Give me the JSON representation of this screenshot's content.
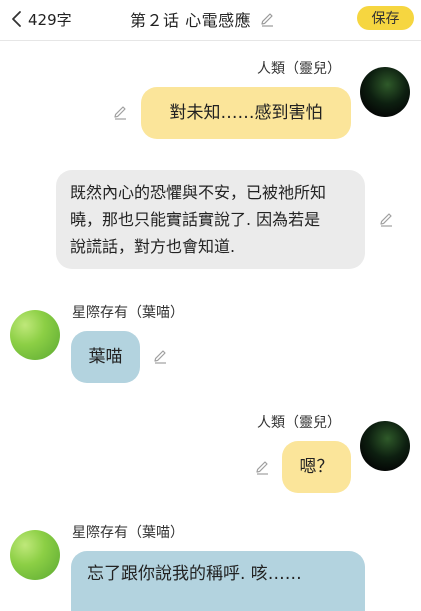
{
  "header": {
    "back_label": "429字",
    "title": "第２话 心電感應",
    "save_label": "保存"
  },
  "messages": [
    {
      "speaker": "人類（靈兒）",
      "text": "對未知……感到害怕"
    },
    {
      "speaker": "",
      "lines": [
        "既然內心的恐懼與不安，已被祂所知",
        "曉，那也只能實話實說了.  因為若是",
        "說謊話，對方也會知道."
      ]
    },
    {
      "speaker": "星際存有（葉喵）",
      "text": "葉喵"
    },
    {
      "speaker": "人類（靈兒）",
      "text": "嗯？"
    },
    {
      "speaker": "星際存有（葉喵）",
      "text": "忘了跟你說我的稱呼.  咳……"
    }
  ],
  "colors": {
    "accent": "#f6d640",
    "bubble_user": "#fbe59a",
    "bubble_other": "#b3d3df",
    "bubble_narration": "#ebebeb"
  },
  "icons": {
    "back": "chevron-left-icon",
    "edit": "pencil-icon"
  }
}
